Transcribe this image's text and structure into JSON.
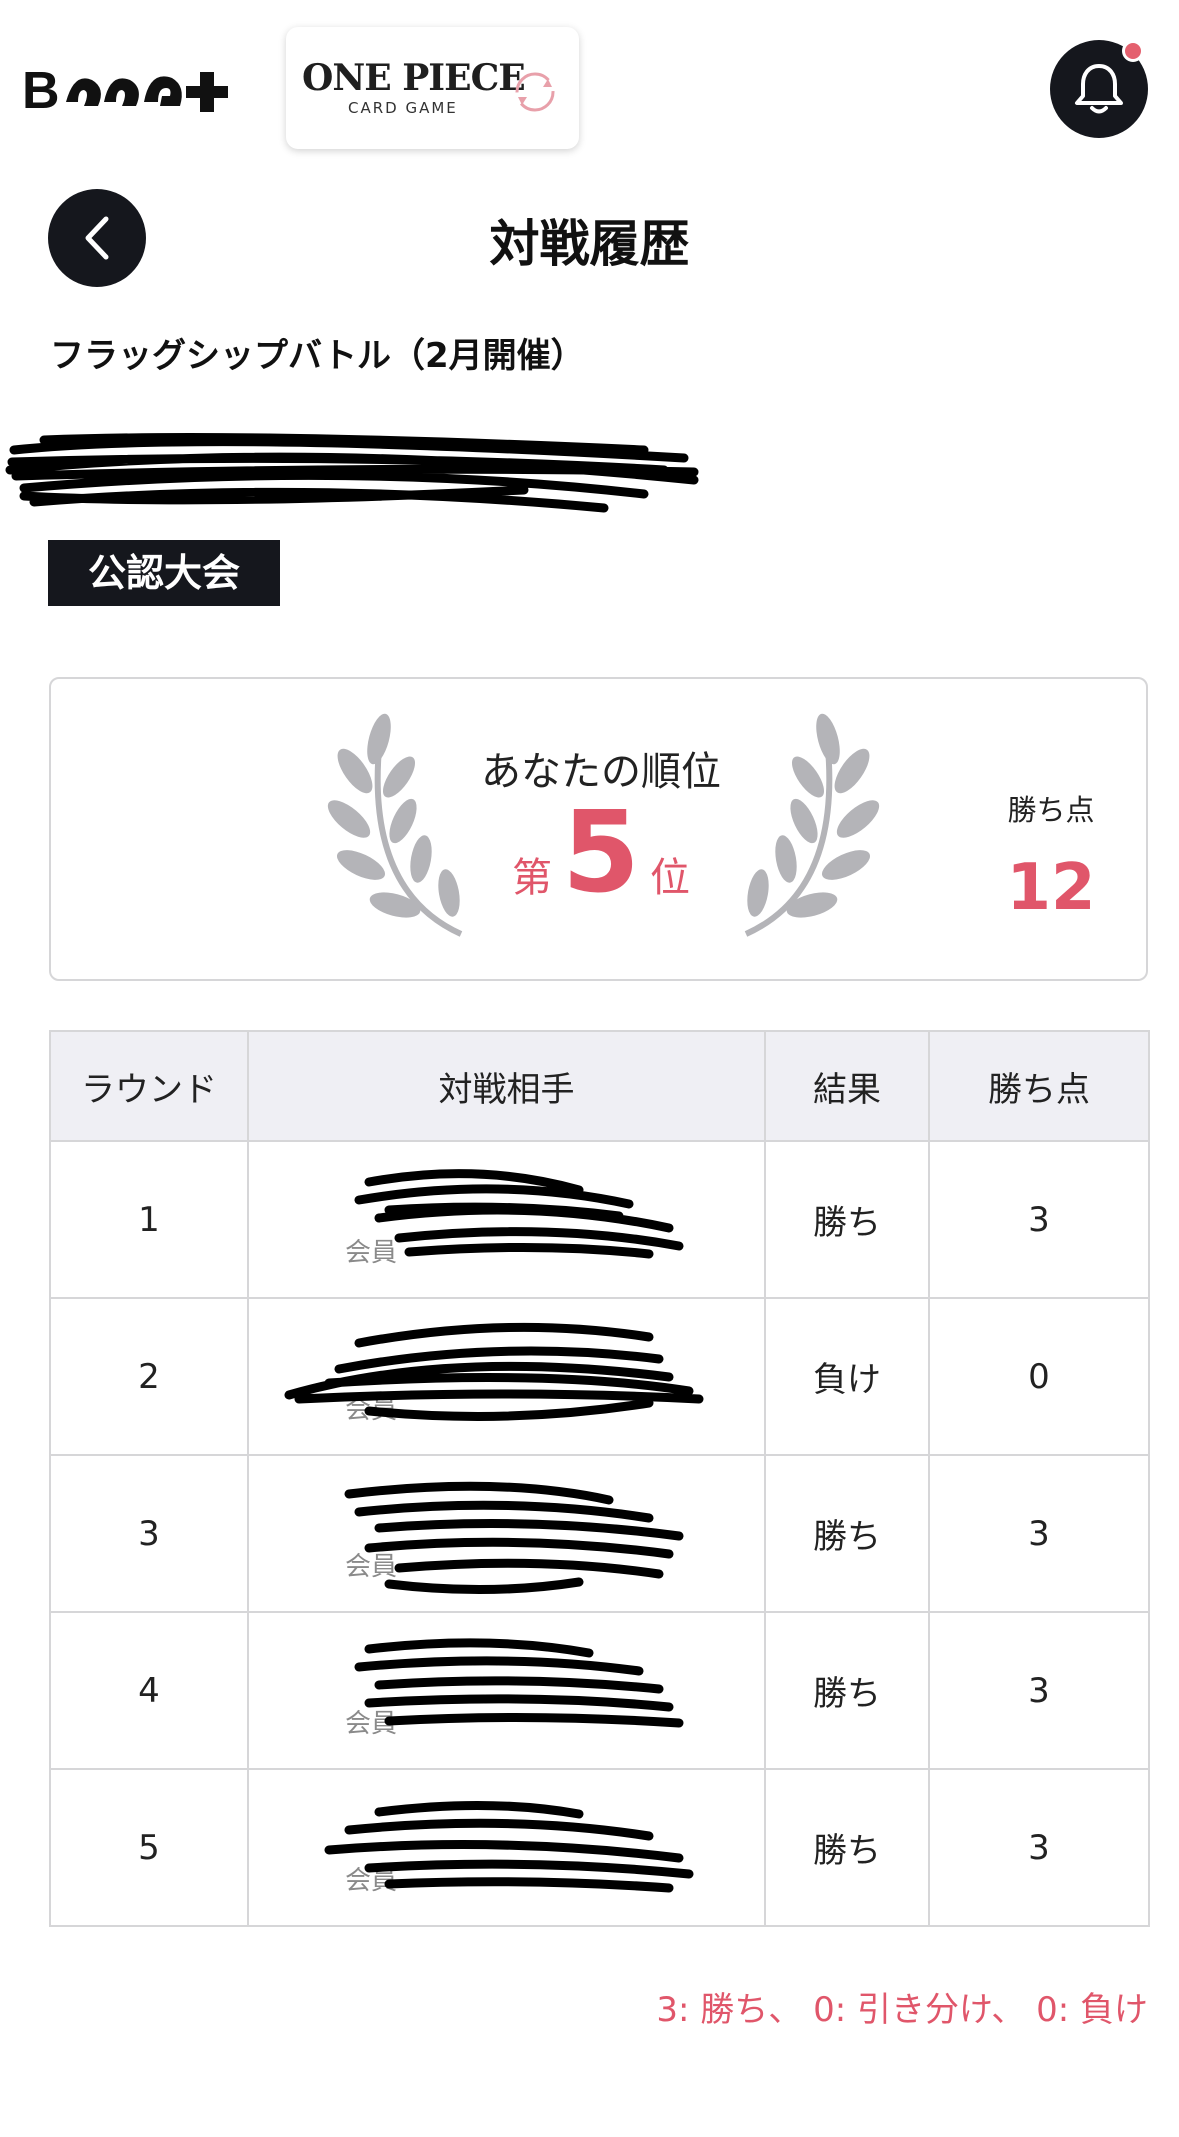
{
  "header": {
    "brand_logo_text": "BCG+",
    "game_title": "ONE PIECE",
    "game_subtitle": "CARD GAME",
    "notification_badge": true
  },
  "page": {
    "title": "対戦履歴",
    "event_name": "フラッグシップバトル（2月開催）",
    "badge": "公認大会"
  },
  "ranking": {
    "label": "あなたの順位",
    "rank_prefix": "第",
    "rank": "5",
    "rank_suffix": "位",
    "points_label": "勝ち点",
    "points": "12"
  },
  "table": {
    "headers": [
      "ラウンド",
      "対戦相手",
      "結果",
      "勝ち点"
    ],
    "member_hint": "会員",
    "rows": [
      {
        "round": "1",
        "result": "勝ち",
        "points": "3"
      },
      {
        "round": "2",
        "result": "負け",
        "points": "0"
      },
      {
        "round": "3",
        "result": "勝ち",
        "points": "3"
      },
      {
        "round": "4",
        "result": "勝ち",
        "points": "3"
      },
      {
        "round": "5",
        "result": "勝ち",
        "points": "3"
      }
    ]
  },
  "legend": "3: 勝ち、 0: 引き分け、 0: 負け",
  "colors": {
    "accent": "#e0566a",
    "dark": "#15171d",
    "border": "#d6d6d8",
    "header_bg": "#efeff4",
    "laurel": "#b4b4b8"
  }
}
